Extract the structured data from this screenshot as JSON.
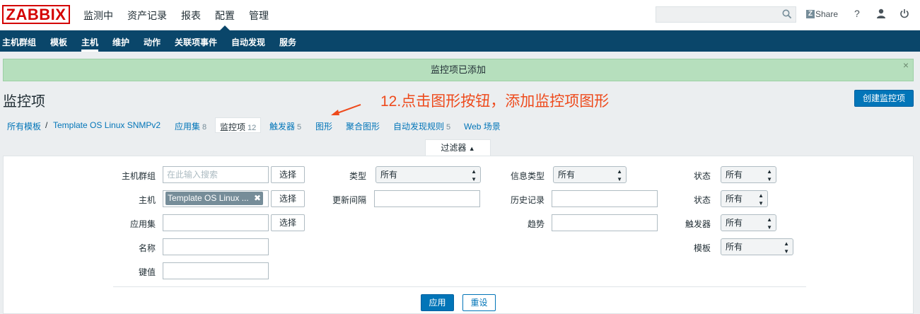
{
  "app": {
    "logo": "ZABBIX"
  },
  "main_menu": [
    "监测中",
    "资产记录",
    "报表",
    "配置",
    "管理"
  ],
  "header": {
    "search_value": "",
    "share_label": "Share",
    "help_label": "?"
  },
  "sub_menu": [
    "主机群组",
    "模板",
    "主机",
    "维护",
    "动作",
    "关联项事件",
    "自动发现",
    "服务"
  ],
  "sub_menu_active": "主机",
  "message": {
    "text": "监控项已添加",
    "close": "×"
  },
  "page": {
    "title": "监控项",
    "create_button": "创建监控项"
  },
  "annotation": {
    "text": "12.点击图形按钮，添加监控项图形",
    "color": "#ee4a1c"
  },
  "breadcrumb": {
    "all_templates": "所有模板",
    "separator": "/",
    "template": "Template OS Linux SNMPv2",
    "applications": {
      "label": "应用集",
      "count": "8"
    },
    "items": {
      "label": "监控项",
      "count": "12"
    },
    "triggers": {
      "label": "触发器",
      "count": "5"
    },
    "graphs": {
      "label": "图形"
    },
    "screens": {
      "label": "聚合图形"
    },
    "discovery": {
      "label": "自动发现规则",
      "count": "5"
    },
    "web": {
      "label": "Web 场景"
    }
  },
  "filter": {
    "tab_label": "过滤器",
    "host_groups": {
      "label": "主机群组",
      "placeholder": "在此输入搜索",
      "select": "选择"
    },
    "host": {
      "label": "主机",
      "chip": "Template OS Linux ...",
      "select": "选择"
    },
    "application": {
      "label": "应用集",
      "value": "",
      "select": "选择"
    },
    "name": {
      "label": "名称",
      "value": ""
    },
    "key": {
      "label": "键值",
      "value": ""
    },
    "type": {
      "label": "类型",
      "value": "所有"
    },
    "update_interval": {
      "label": "更新间隔",
      "value": ""
    },
    "info_type": {
      "label": "信息类型",
      "value": "所有"
    },
    "history": {
      "label": "历史记录",
      "value": ""
    },
    "trends": {
      "label": "趋势",
      "value": ""
    },
    "state1": {
      "label": "状态",
      "value": "所有"
    },
    "state2": {
      "label": "状态",
      "value": "所有"
    },
    "triggers": {
      "label": "触发器",
      "value": "所有"
    },
    "template": {
      "label": "模板",
      "value": "所有"
    },
    "apply": "应用",
    "reset": "重设"
  },
  "colors": {
    "accent": "#0275b8",
    "submenu_bg": "#0a466a",
    "message_bg": "#b6dfbd",
    "brand": "#d40000"
  }
}
